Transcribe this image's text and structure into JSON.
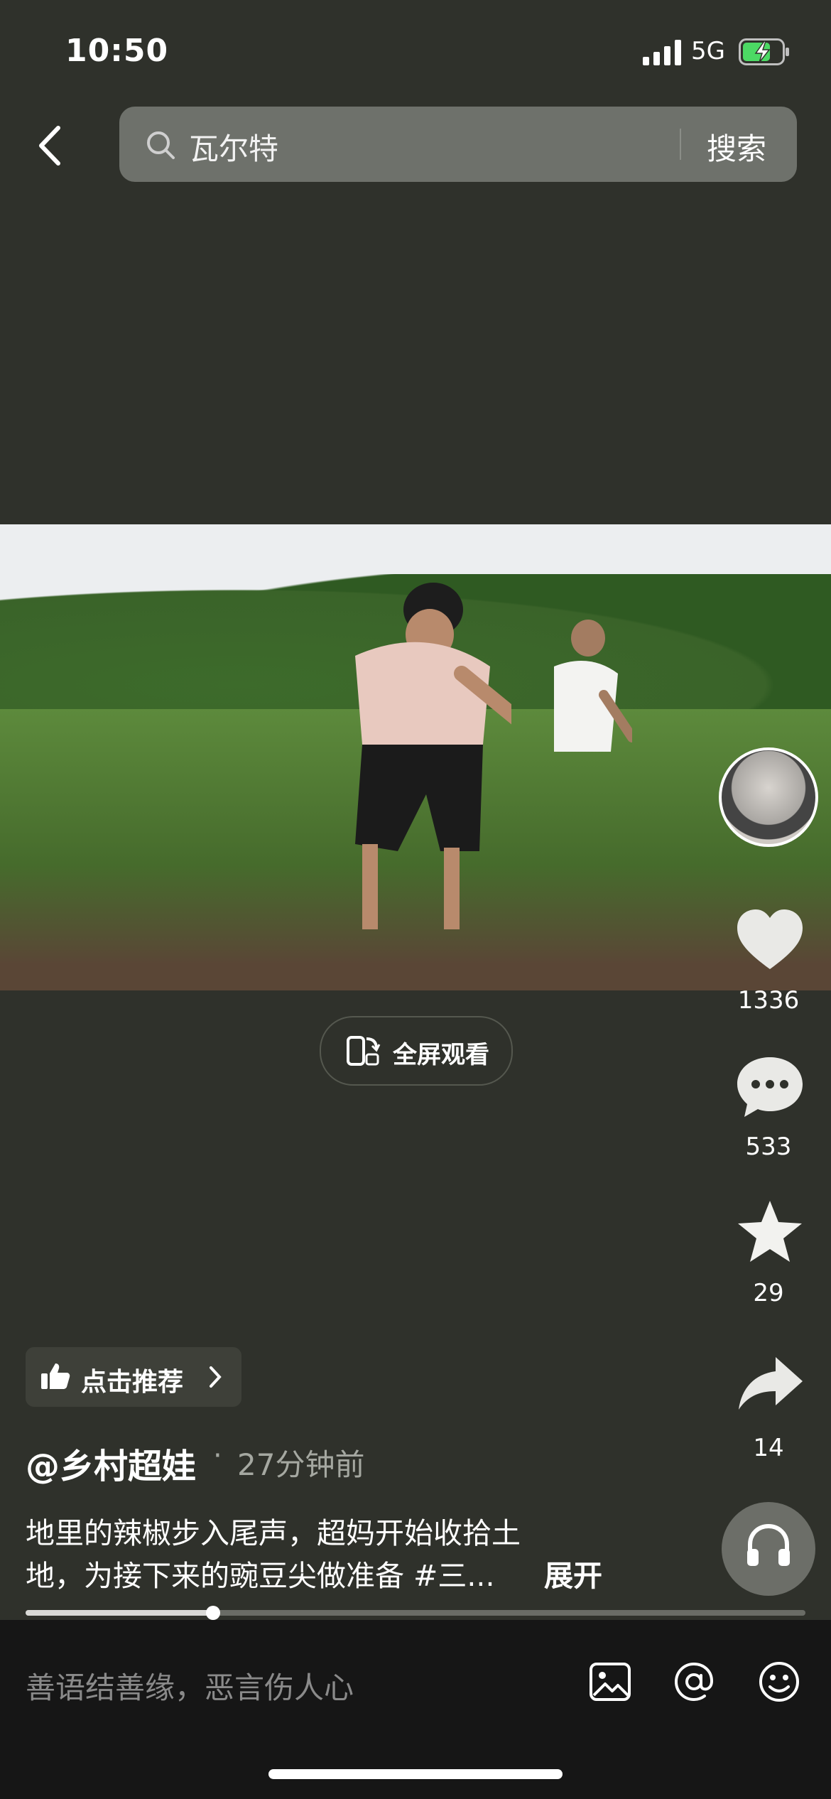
{
  "status_bar": {
    "time": "10:50",
    "network": "5G"
  },
  "search": {
    "query": "瓦尔特",
    "button_label": "搜索"
  },
  "video": {
    "fullscreen_label": "全屏观看"
  },
  "actions": {
    "likes": "1336",
    "comments": "533",
    "favorites": "29",
    "shares": "14"
  },
  "recommend": {
    "label": "点击推荐"
  },
  "post": {
    "author": "@乡村超娃",
    "separator": "·",
    "posted_time": "27分钟前",
    "description_line1": "地里的辣椒步入尾声，超妈开始收拾土",
    "description_line2": "地，为接下来的豌豆尖做准备 #三...",
    "expand_label": "展开"
  },
  "progress": {
    "fraction": 0.24
  },
  "comment": {
    "placeholder": "善语结善缘，恶言伤人心"
  },
  "colors": {
    "background": "#2f312b",
    "comment_bar": "#161616",
    "battery_accent": "#4cd964"
  }
}
